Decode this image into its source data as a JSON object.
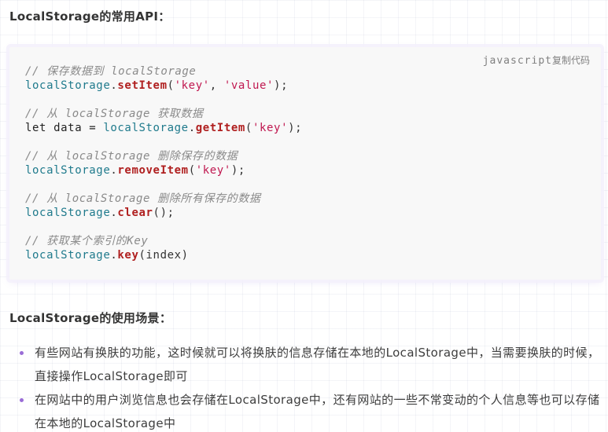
{
  "section_api": {
    "title": "LocalStorage的常用API："
  },
  "code_block": {
    "language": "javascript",
    "copy_label": "复制代码",
    "lines": [
      [
        {
          "t": "comment",
          "v": "// 保存数据到 localStorage"
        }
      ],
      [
        {
          "t": "obj",
          "v": "localStorage"
        },
        {
          "t": "punc",
          "v": "."
        },
        {
          "t": "method",
          "v": "setItem"
        },
        {
          "t": "punc",
          "v": "("
        },
        {
          "t": "str",
          "v": "'key'"
        },
        {
          "t": "punc",
          "v": ", "
        },
        {
          "t": "str",
          "v": "'value'"
        },
        {
          "t": "punc",
          "v": ");"
        }
      ],
      [],
      [
        {
          "t": "comment",
          "v": "// 从 localStorage 获取数据"
        }
      ],
      [
        {
          "t": "kw",
          "v": "let"
        },
        {
          "t": "plain",
          "v": " data = "
        },
        {
          "t": "obj",
          "v": "localStorage"
        },
        {
          "t": "punc",
          "v": "."
        },
        {
          "t": "method",
          "v": "getItem"
        },
        {
          "t": "punc",
          "v": "("
        },
        {
          "t": "str",
          "v": "'key'"
        },
        {
          "t": "punc",
          "v": ");"
        }
      ],
      [],
      [
        {
          "t": "comment",
          "v": "// 从 localStorage 删除保存的数据"
        }
      ],
      [
        {
          "t": "obj",
          "v": "localStorage"
        },
        {
          "t": "punc",
          "v": "."
        },
        {
          "t": "method",
          "v": "removeItem"
        },
        {
          "t": "punc",
          "v": "("
        },
        {
          "t": "str",
          "v": "'key'"
        },
        {
          "t": "punc",
          "v": ");"
        }
      ],
      [],
      [
        {
          "t": "comment",
          "v": "// 从 localStorage 删除所有保存的数据"
        }
      ],
      [
        {
          "t": "obj",
          "v": "localStorage"
        },
        {
          "t": "punc",
          "v": "."
        },
        {
          "t": "method",
          "v": "clear"
        },
        {
          "t": "punc",
          "v": "();"
        }
      ],
      [],
      [
        {
          "t": "comment",
          "v": "// 获取某个索引的Key"
        }
      ],
      [
        {
          "t": "obj",
          "v": "localStorage"
        },
        {
          "t": "punc",
          "v": "."
        },
        {
          "t": "method",
          "v": "key"
        },
        {
          "t": "punc",
          "v": "(index)"
        }
      ]
    ]
  },
  "section_usage": {
    "title": "LocalStorage的使用场景：",
    "items": [
      "有些网站有换肤的功能，这时候就可以将换肤的信息存储在本地的LocalStorage中，当需要换肤的时候，直接操作LocalStorage即可",
      "在网站中的用户浏览信息也会存储在LocalStorage中，还有网站的一些不常变动的个人信息等也可以存储在本地的LocalStorage中"
    ]
  },
  "colors": {
    "bullet": "#9a6dd7",
    "code_bg": "#f8f8f8",
    "comment": "#8a8a8a",
    "object": "#1f7a8c",
    "method": "#b02020",
    "string": "#c01850"
  }
}
